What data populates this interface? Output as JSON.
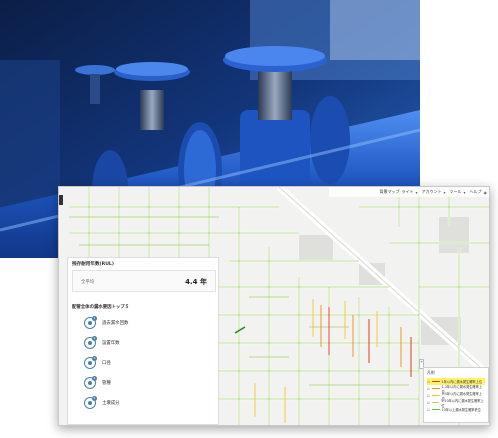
{
  "photo": {
    "subject": "blue-pipeline-valves"
  },
  "app": {
    "toolbar": {
      "basemap_label": "背景マップ",
      "basemap_value": "ライト",
      "account_label": "アカウント",
      "tools_label": "ツール",
      "tools_value": "ツール",
      "help_label": "ヘルプ"
    },
    "panel": {
      "rul_title": "残存耐用年数(RUL)",
      "rul_label": "全平均",
      "rul_value": "4.4 年",
      "factors_title": "配管全体の漏水要因トップ５",
      "factors": [
        {
          "rank": "1",
          "name": "過去漏水回数"
        },
        {
          "rank": "2",
          "name": "設置年数"
        },
        {
          "rank": "3",
          "name": "口径"
        },
        {
          "rank": "4",
          "name": "管種"
        },
        {
          "rank": "5",
          "name": "土壌成分"
        }
      ]
    },
    "legend": {
      "title": "凡例",
      "rows": [
        {
          "label": "1年以内に漏水発生確率上位",
          "color": "#e53b1e",
          "highlight": true
        },
        {
          "label": "1-3年以内に漏水発生確率上位",
          "color": "#f08a1c",
          "highlight": false
        },
        {
          "label": "3-5年以内に漏水発生確率上位",
          "color": "#f3c62b",
          "highlight": false
        },
        {
          "label": "5-10年以内に漏水発生確率上位",
          "color": "#b7d23b",
          "highlight": false
        },
        {
          "label": "10年以上漏水発生確率低位",
          "color": "#5fbf3e",
          "highlight": false
        }
      ]
    },
    "colors": {
      "accent": "#4a7fa8",
      "map_bg": "#f2f2f0",
      "road": "#ffffff"
    }
  }
}
